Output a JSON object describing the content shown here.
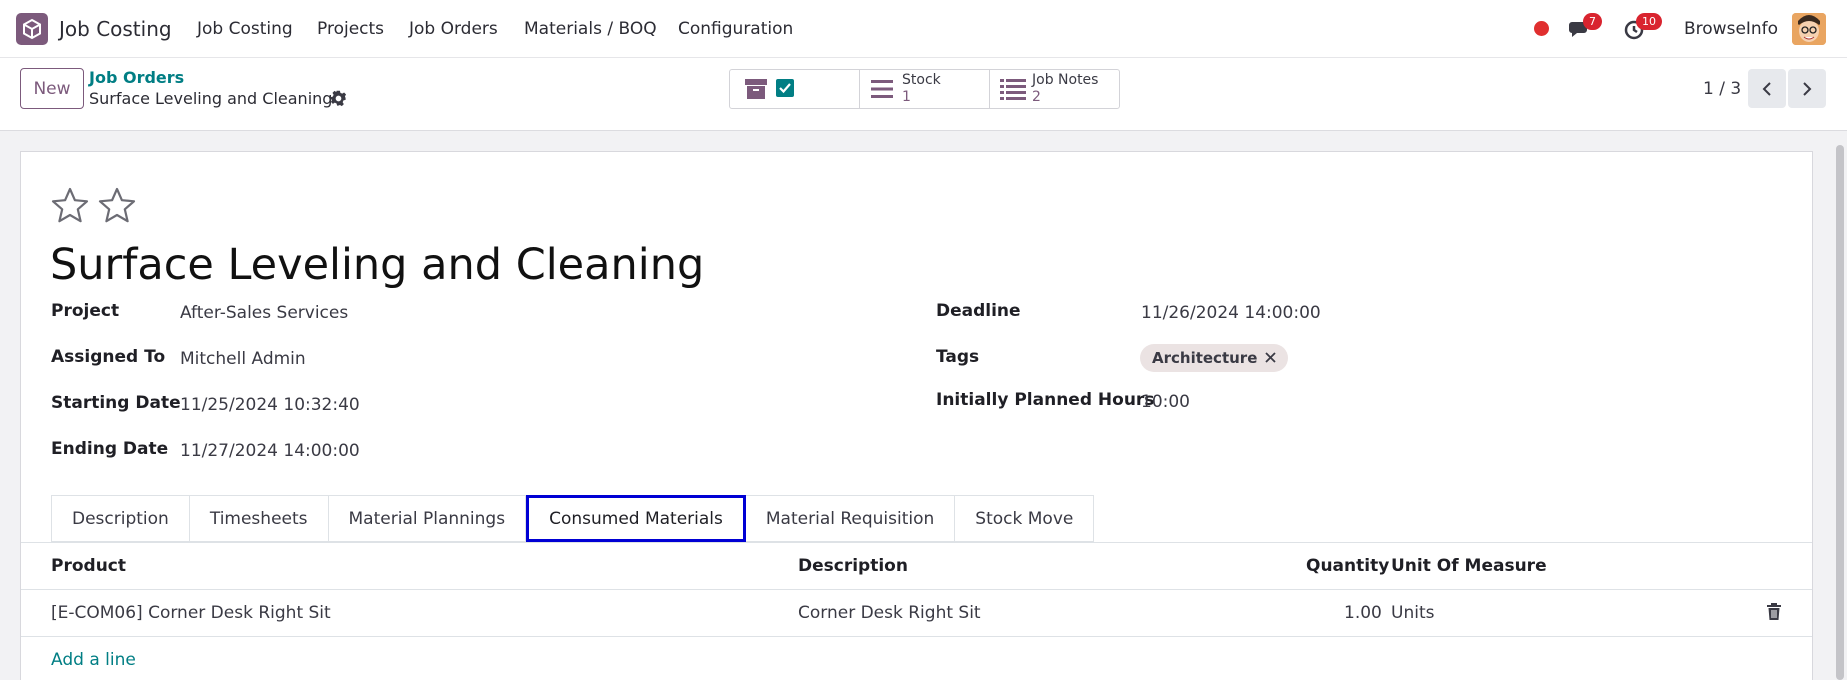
{
  "navbar": {
    "app_name": "Job Costing",
    "menu": [
      "Job Costing",
      "Projects",
      "Job Orders",
      "Materials / BOQ",
      "Configuration"
    ],
    "messages_count": "7",
    "activities_count": "10",
    "user_name": "BrowseInfo"
  },
  "control": {
    "new_label": "New",
    "breadcrumb_parent": "Job Orders",
    "breadcrumb_current": "Surface Leveling and Cleaning",
    "smart_buttons": [
      {
        "label": "Stock",
        "value": "1"
      },
      {
        "label": "Job Notes",
        "value": "2"
      }
    ],
    "pager": "1 / 3"
  },
  "record": {
    "priority_stars": 0,
    "title": "Surface Leveling and Cleaning",
    "fields_left": [
      {
        "label": "Project",
        "value": "After-Sales Services"
      },
      {
        "label": "Assigned To",
        "value": "Mitchell Admin"
      },
      {
        "label": "Starting Date",
        "value": "11/25/2024 10:32:40"
      },
      {
        "label": "Ending Date",
        "value": "11/27/2024 14:00:00"
      }
    ],
    "fields_right": [
      {
        "label": "Deadline",
        "value": "11/26/2024 14:00:00"
      },
      {
        "label": "Tags",
        "value": "Architecture"
      },
      {
        "label": "Initially Planned Hours",
        "value": "10:00"
      }
    ]
  },
  "tabs": [
    "Description",
    "Timesheets",
    "Material Plannings",
    "Consumed Materials",
    "Material Requisition",
    "Stock Move"
  ],
  "active_tab": "Consumed Materials",
  "table": {
    "headers": {
      "product": "Product",
      "description": "Description",
      "quantity": "Quantity",
      "uom": "Unit Of Measure"
    },
    "rows": [
      {
        "product": "[E-COM06] Corner Desk Right Sit",
        "description": "Corner Desk Right Sit",
        "quantity": "1.00",
        "uom": "Units"
      }
    ],
    "add_line": "Add a line"
  },
  "colors": {
    "brand": "#7c5a7c",
    "link": "#017e84",
    "highlight": "#0000d4",
    "badge": "#d9242f"
  }
}
